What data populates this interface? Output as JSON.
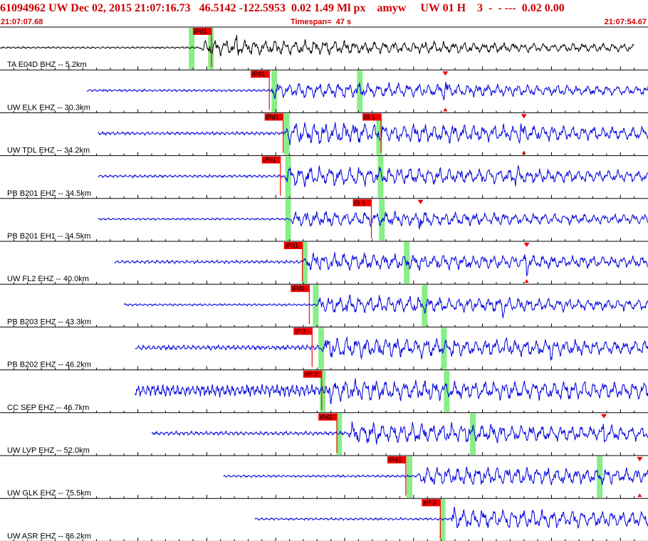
{
  "header": {
    "title": "61094962 UW Dec 02, 2015 21:07:16.73   46.5142 -122.5953  0.02 1.49 Ml px    amyw     UW 01 H    3  -  - ---  0.02 0.00",
    "start_time": "21:07:07.68",
    "timespan": "Timespan=  47 s",
    "end_time": "21:07:54.67"
  },
  "colors": {
    "trace_blue": "#0000dd",
    "trace_black": "#000000",
    "pick_flag": "#ee0000",
    "pick_line": "#ff0000",
    "window_green": "#88ee88",
    "header_red": "#cc0000"
  },
  "chart_data": {
    "type": "line",
    "title": "",
    "xlabel": "",
    "ylabel": "",
    "time_range": [
      "21:07:07.68",
      "21:07:54.67"
    ],
    "timespan_s": 47,
    "traces": [
      {
        "label": "TA E04D BHZ -- 5.2km",
        "color": "black",
        "start": 0,
        "end": 46,
        "amp": 0.12,
        "onset": 14.5,
        "pcoda": 0.45,
        "peak": 17.2,
        "peakamp": 1.0,
        "seed": 3,
        "picks": [
          {
            "label": "iPd1",
            "t": 14.2
          }
        ],
        "green": [
          13.9,
          15.3
        ],
        "tri": null
      },
      {
        "label": "UW ELK EHZ -- 30.3km",
        "color": "blue",
        "start": 6.3,
        "end": 52.6,
        "amp": 0.16,
        "onset": 19.6,
        "pcoda": 0.45,
        "peak": 32.3,
        "peakamp": 1.0,
        "seed": 11,
        "picks": [
          {
            "label": "iPd1",
            "t": 18.4
          }
        ],
        "green": [
          19.9,
          26.1
        ],
        "tri": {
          "t": 32.3,
          "top": true,
          "bottom": true
        }
      },
      {
        "label": "UW TDL EHZ -- 34.2km",
        "color": "blue",
        "start": 7.1,
        "end": 53.5,
        "amp": 0.15,
        "onset": 20.6,
        "pcoda": 0.6,
        "peak": 37.8,
        "peakamp": 1.0,
        "seed": 17,
        "picks": [
          {
            "label": "iPd1",
            "t": 19.4
          },
          {
            "label": "iS 1",
            "t": 26.5
          }
        ],
        "green": [
          20.8,
          27.5
        ],
        "tri": {
          "t": 38.0,
          "top": true,
          "bottom": true
        }
      },
      {
        "label": "PB B201 EHZ -- 34.5km",
        "color": "blue",
        "start": 7.1,
        "end": 53.5,
        "amp": 0.15,
        "onset": 20.6,
        "pcoda": 0.55,
        "peak": 37.5,
        "peakamp": 1.0,
        "seed": 23,
        "picks": [
          {
            "label": "iPd1",
            "t": 19.2
          }
        ],
        "green": [
          20.9,
          27.6
        ],
        "tri": null
      },
      {
        "label": "PB B201 EH1 -- 34.5km",
        "color": "blue",
        "start": 7.1,
        "end": 53.5,
        "amp": 0.13,
        "onset": 21.0,
        "pcoda": 0.45,
        "peak": 30.5,
        "peakamp": 0.85,
        "seed": 29,
        "picks": [
          {
            "label": "iS 1",
            "t": 25.8
          }
        ],
        "green": [
          20.9,
          27.7
        ],
        "tri": {
          "t": 30.5,
          "top": true,
          "bottom": false
        }
      },
      {
        "label": "UW FL2 EHZ -- 40.0km",
        "color": "blue",
        "start": 8.3,
        "end": 54.5,
        "amp": 0.18,
        "onset": 22.0,
        "pcoda": 0.5,
        "peak": 38.2,
        "peakamp": 1.0,
        "seed": 31,
        "picks": [
          {
            "label": "iPd1",
            "t": 20.8
          }
        ],
        "green": [
          22.1,
          29.5
        ],
        "tri": {
          "t": 38.2,
          "top": true,
          "bottom": true
        }
      },
      {
        "label": "PB B203 EHZ -- 43.3km",
        "color": "blue",
        "start": 9.0,
        "end": 55.0,
        "amp": 0.12,
        "onset": 22.9,
        "pcoda": 0.5,
        "peak": 36.5,
        "peakamp": 0.9,
        "seed": 37,
        "picks": [
          {
            "label": "iPd1",
            "t": 21.3
          }
        ],
        "green": [
          22.9,
          30.8
        ],
        "tri": null
      },
      {
        "label": "PB B202 EHZ -- 46.2km",
        "color": "blue",
        "start": 9.8,
        "end": 56.2,
        "amp": 0.22,
        "onset": 23.3,
        "pcoda": 0.6,
        "peak": 40.0,
        "peakamp": 0.9,
        "seed": 41,
        "picks": [
          {
            "label": "iP 2",
            "t": 21.5
          }
        ],
        "green": [
          23.3,
          32.2
        ],
        "tri": null
      },
      {
        "label": "CC SEP EHZ -- 46.7km",
        "color": "blue",
        "start": 9.8,
        "end": 56.2,
        "amp": 0.55,
        "onset": 23.6,
        "pcoda": 0.6,
        "peak": 24.0,
        "peakamp": 1.0,
        "seed": 43,
        "picks": [
          {
            "label": "eP 2",
            "t": 22.2
          }
        ],
        "green": [
          23.4,
          32.4
        ],
        "tri": null
      },
      {
        "label": "UW LVP EHZ -- 52.0km",
        "color": "blue",
        "start": 11.0,
        "end": 57.5,
        "amp": 0.18,
        "onset": 25.2,
        "pcoda": 0.6,
        "peak": 43.8,
        "peakamp": 1.0,
        "seed": 47,
        "picks": [
          {
            "label": "iPd1",
            "t": 23.3
          }
        ],
        "green": [
          24.6,
          34.3
        ],
        "tri": {
          "t": 43.8,
          "top": true,
          "bottom": false
        }
      },
      {
        "label": "UW GLK EHZ -- 75.5km",
        "color": "blue",
        "start": 16.2,
        "end": 62.7,
        "amp": 0.12,
        "onset": 30.3,
        "pcoda": 0.55,
        "peak": 46.3,
        "peakamp": 0.7,
        "seed": 53,
        "picks": [
          {
            "label": "iPd1",
            "t": 28.3
          }
        ],
        "green": [
          29.7,
          43.5
        ],
        "tri": {
          "t": 46.4,
          "top": true,
          "bottom": true
        }
      },
      {
        "label": "UW ASR EHZ -- 86.2km",
        "color": "blue",
        "start": 18.5,
        "end": 65.0,
        "amp": 0.12,
        "onset": 32.8,
        "pcoda": 0.55,
        "peak": 33.0,
        "peakamp": 0.9,
        "seed": 59,
        "picks": [
          {
            "label": "eP 2",
            "t": 30.8
          }
        ],
        "green": [
          32.1,
          47.7
        ],
        "tri": null
      }
    ]
  }
}
